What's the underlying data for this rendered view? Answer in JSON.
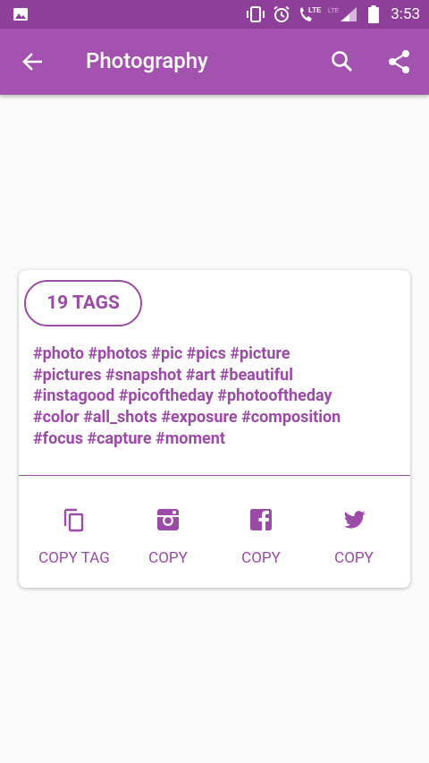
{
  "status_bar": {
    "time": "3:53",
    "icons": [
      "image-icon",
      "vibrate-icon",
      "alarm-icon",
      "volte-icon",
      "lte-signal-icon",
      "battery-icon"
    ]
  },
  "app_bar": {
    "title": "Photography",
    "icons": [
      "back-arrow-icon",
      "search-icon",
      "share-icon"
    ]
  },
  "card": {
    "tag_count": "19 TAGS",
    "tags_lines": [
      "#photo #photos #pic #pics #picture",
      "#pictures #snapshot #art #beautiful",
      "#instagood #picoftheday #photooftheday",
      "#color #all_shots #exposure #composition",
      "#focus #capture #moment"
    ],
    "actions": [
      {
        "label": "COPY TAG",
        "icon": "copy-icon"
      },
      {
        "label": "COPY",
        "icon": "instagram-icon"
      },
      {
        "label": "COPY",
        "icon": "facebook-icon"
      },
      {
        "label": "COPY",
        "icon": "twitter-icon"
      }
    ]
  },
  "colors": {
    "status_bar": "#8e3f99",
    "app_bar": "#a452b0",
    "accent": "#9c4aa8",
    "background": "#fafafa",
    "card": "#ffffff"
  }
}
